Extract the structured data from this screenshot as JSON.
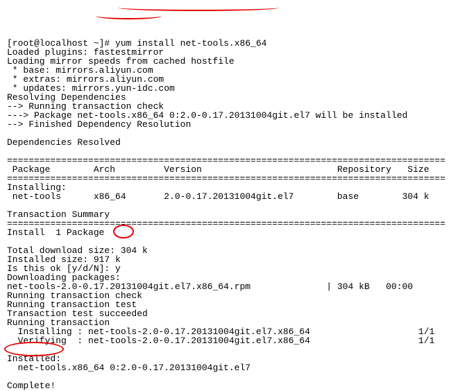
{
  "prompt": {
    "user_host": "[root@localhost ~]#",
    "command": "yum install net-tools.x86_64"
  },
  "plugins_line": "Loaded plugins: fastestmirror",
  "mirror_speeds": "Loading mirror speeds from cached hostfile",
  "base_mirror": " * base: mirrors.aliyun.com",
  "extras_mirror": " * extras: mirrors.aliyun.com",
  "updates_mirror": " * updates: mirrors.yun-idc.com",
  "resolving": "Resolving Dependencies",
  "trans_check": "--> Running transaction check",
  "pkg_install": "---> Package net-tools.x86_64 0:2.0-0.17.20131004git.el7 will be installed",
  "dep_done": "--> Finished Dependency Resolution",
  "deps_resolved": "Dependencies Resolved",
  "divider": "=================================================================================",
  "header_row": " Package        Arch         Version                         Repository   Size",
  "installing_hdr": "Installing:",
  "pkg_row": " net-tools      x86_64       2.0-0.17.20131004git.el7        base        304 k",
  "trans_summary": "Transaction Summary",
  "install_count": "Install  1 Package",
  "dl_size": "Total download size: 304 k",
  "inst_size": "Installed size: 917 k",
  "confirm_prompt": "Is this ok [y/d/N]: ",
  "confirm_answer": "y",
  "downloading": "Downloading packages:",
  "rpm_line": "net-tools-2.0-0.17.20131004git.el7.x86_64.rpm              | 304 kB   00:00",
  "run_check": "Running transaction check",
  "run_test": "Running transaction test",
  "test_ok": "Transaction test succeeded",
  "run_trans": "Running transaction",
  "installing_pkg": "  Installing : net-tools-2.0-0.17.20131004git.el7.x86_64                    1/1",
  "verifying_pkg": "  Verifying  : net-tools-2.0-0.17.20131004git.el7.x86_64                    1/1",
  "installed_hdr": "Installed:",
  "installed_pkg": "  net-tools.x86_64 0:2.0-0.17.20131004git.el7",
  "complete": "Complete!"
}
